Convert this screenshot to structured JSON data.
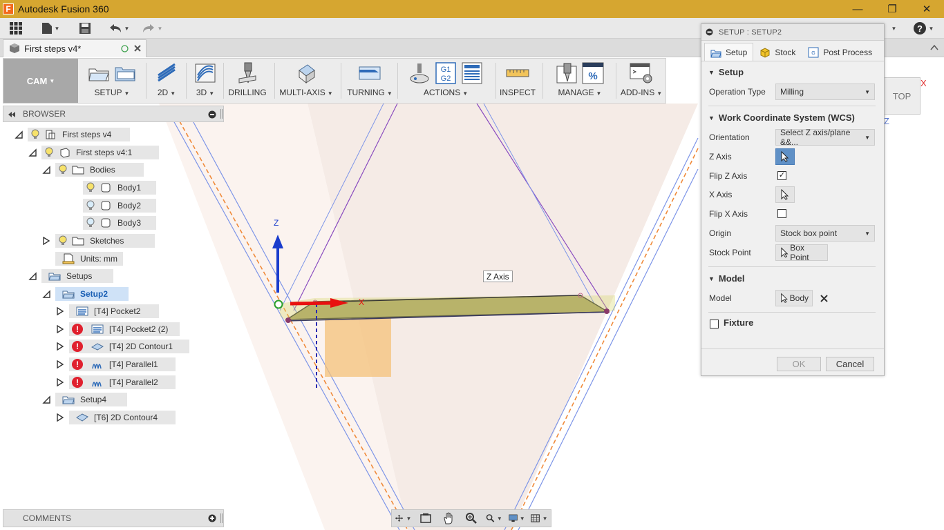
{
  "window": {
    "title": "Autodesk Fusion 360",
    "app_icon_letter": "F",
    "minimize": "—",
    "restore": "❐",
    "close": "✕"
  },
  "document": {
    "tab_title": "First steps v4*"
  },
  "toolbar": {
    "workspace": "CAM",
    "groups": [
      {
        "label": "SETUP",
        "dropdown": true
      },
      {
        "label": "2D",
        "dropdown": true
      },
      {
        "label": "3D",
        "dropdown": true
      },
      {
        "label": "DRILLING",
        "dropdown": false
      },
      {
        "label": "MULTI-AXIS",
        "dropdown": true
      },
      {
        "label": "TURNING",
        "dropdown": true
      },
      {
        "label": "ACTIONS",
        "dropdown": true
      },
      {
        "label": "INSPECT",
        "dropdown": false
      },
      {
        "label": "MANAGE",
        "dropdown": true
      },
      {
        "label": "ADD-INS",
        "dropdown": true
      }
    ],
    "actions_icon_text_1": "G1",
    "actions_icon_text_2": "G2",
    "manage_icon_text": "%"
  },
  "browser": {
    "title": "BROWSER",
    "nodes": [
      {
        "label": "First steps v4"
      },
      {
        "label": "First steps v4:1"
      },
      {
        "label": "Bodies"
      },
      {
        "label": "Body1"
      },
      {
        "label": "Body2"
      },
      {
        "label": "Body3"
      },
      {
        "label": "Sketches"
      },
      {
        "label": "Units: mm"
      },
      {
        "label": "Setups"
      },
      {
        "label": "Setup2"
      },
      {
        "label": "[T4] Pocket2"
      },
      {
        "label": "[T4] Pocket2 (2)"
      },
      {
        "label": "[T4] 2D Contour1"
      },
      {
        "label": "[T4] Parallel1"
      },
      {
        "label": "[T4] Parallel2"
      },
      {
        "label": "Setup4"
      },
      {
        "label": "[T6] 2D Contour4"
      }
    ],
    "error_mark": "!"
  },
  "comments": {
    "title": "COMMENTS"
  },
  "viewport": {
    "z_label": "Z",
    "x_label": "X",
    "tooltip": "Z Axis",
    "viewcube_face": "TOP",
    "viewcube_x": "X",
    "viewcube_z": "Z"
  },
  "dialog": {
    "title": "SETUP : SETUP2",
    "tabs": [
      "Setup",
      "Stock",
      "Post Process"
    ],
    "section_setup": "Setup",
    "operation_type_label": "Operation Type",
    "operation_type_value": "Milling",
    "section_wcs": "Work Coordinate System (WCS)",
    "orientation_label": "Orientation",
    "orientation_value": "Select Z axis/plane &&...",
    "z_axis_label": "Z Axis",
    "flip_z_label": "Flip Z Axis",
    "flip_z_checked": true,
    "x_axis_label": "X Axis",
    "flip_x_label": "Flip X Axis",
    "flip_x_checked": false,
    "origin_label": "Origin",
    "origin_value": "Stock box point",
    "stock_point_label": "Stock Point",
    "stock_point_value": "Box Point",
    "section_model": "Model",
    "model_label": "Model",
    "model_value": "Body",
    "fixture_label": "Fixture",
    "fixture_checked": false,
    "ok": "OK",
    "cancel": "Cancel"
  },
  "colors": {
    "titlebar": "#d6a630",
    "selection_blue": "#5f90c6",
    "error_red": "#e0202e",
    "stock_fill": "#f4c27a"
  }
}
